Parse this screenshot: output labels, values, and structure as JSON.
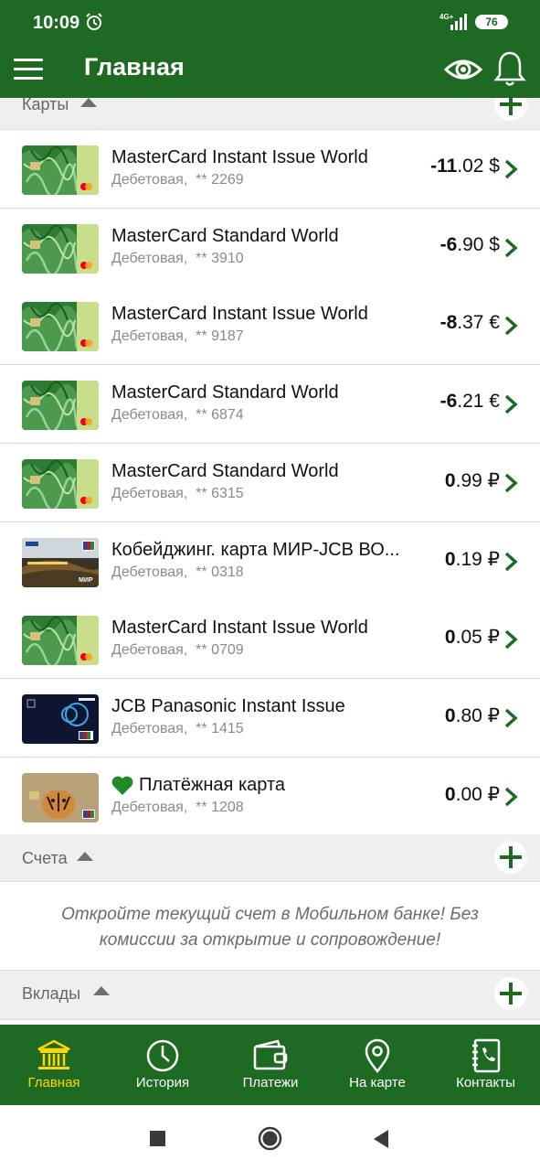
{
  "status": {
    "time": "10:09",
    "network": "4G+",
    "battery": "76"
  },
  "appbar": {
    "title": "Главная"
  },
  "cards_section": {
    "label": "Карты"
  },
  "cards": [
    {
      "name": "MasterCard Instant Issue World",
      "type": "Дебетовая,",
      "number": "** 2269",
      "amount_main": "-11",
      "amount_rest": ".02 $",
      "style": "green"
    },
    {
      "name": "MasterCard Standard World",
      "type": "Дебетовая,",
      "number": "** 3910",
      "amount_main": "-6",
      "amount_rest": ".90 $",
      "style": "green"
    },
    {
      "name": "MasterCard Instant Issue World",
      "type": "Дебетовая,",
      "number": "** 9187",
      "amount_main": "-8",
      "amount_rest": ".37 €",
      "style": "green"
    },
    {
      "name": "MasterCard Standard World",
      "type": "Дебетовая,",
      "number": "** 6874",
      "amount_main": "-6",
      "amount_rest": ".21 €",
      "style": "green"
    },
    {
      "name": "MasterCard Standard World",
      "type": "Дебетовая,",
      "number": "** 6315",
      "amount_main": "0",
      "amount_rest": ".99 ₽",
      "style": "green"
    },
    {
      "name": "Кобейджинг. карта МИР-JCB ВО...",
      "type": "Дебетовая,",
      "number": "** 0318",
      "amount_main": "0",
      "amount_rest": ".19 ₽",
      "style": "mir"
    },
    {
      "name": "MasterCard Instant Issue World",
      "type": "Дебетовая,",
      "number": "** 0709",
      "amount_main": "0",
      "amount_rest": ".05 ₽",
      "style": "green"
    },
    {
      "name": "JCB Panasonic Instant Issue",
      "type": "Дебетовая,",
      "number": "** 1415",
      "amount_main": "0",
      "amount_rest": ".80 ₽",
      "style": "panasonic"
    },
    {
      "name": "Платёжная карта",
      "type": "Дебетовая,",
      "number": "** 1208",
      "amount_main": "0",
      "amount_rest": ".00 ₽",
      "style": "tiger",
      "favorite": true
    }
  ],
  "accounts_section": {
    "label": "Счета",
    "info": "Откройте текущий счет в Мобильном банке! Без комиссии за открытие и сопровождение!"
  },
  "deposits_section": {
    "label": "Вклады"
  },
  "tabs": [
    {
      "label": "Главная",
      "icon": "bank-icon",
      "active": true
    },
    {
      "label": "История",
      "icon": "clock-icon",
      "active": false
    },
    {
      "label": "Платежи",
      "icon": "wallet-icon",
      "active": false
    },
    {
      "label": "На карте",
      "icon": "map-pin-icon",
      "active": false
    },
    {
      "label": "Контакты",
      "icon": "contacts-icon",
      "active": false
    }
  ],
  "colors": {
    "brand": "#1e6a23",
    "active_tab": "#ffd700"
  }
}
